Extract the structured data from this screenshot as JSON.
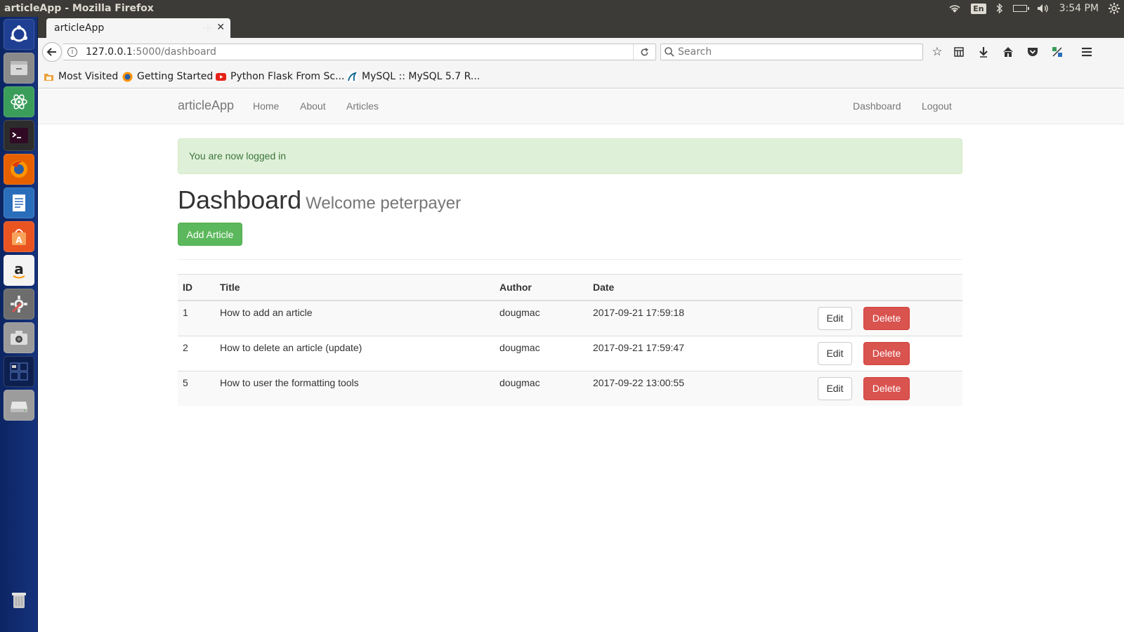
{
  "os": {
    "window_title": "articleApp - Mozilla Firefox",
    "keyboard_layout": "En",
    "clock": "3:54 PM"
  },
  "launcher": {
    "items": [
      "ubuntu-dash-icon",
      "files-icon",
      "atom-editor-icon",
      "terminal-icon",
      "firefox-icon",
      "writer-icon",
      "software-center-icon",
      "amazon-icon",
      "system-settings-icon",
      "camera-icon",
      "workspaces-icon",
      "drive-icon",
      "trash-icon"
    ]
  },
  "browser": {
    "tab_title": "articleApp",
    "url_host": "127.0.0.1",
    "url_path": ":5000/dashboard",
    "search_placeholder": "Search",
    "bookmarks": [
      {
        "label": "Most Visited"
      },
      {
        "label": "Getting Started"
      },
      {
        "label": "Python Flask From Sc..."
      },
      {
        "label": "MySQL :: MySQL 5.7 R..."
      }
    ]
  },
  "site": {
    "brand": "articleApp",
    "nav_left": [
      "Home",
      "About",
      "Articles"
    ],
    "nav_right": [
      "Dashboard",
      "Logout"
    ],
    "alert": "You are now logged in",
    "heading": "Dashboard",
    "welcome": "Welcome peterpayer",
    "add_button": "Add Article",
    "table": {
      "headers": [
        "ID",
        "Title",
        "Author",
        "Date"
      ],
      "rows": [
        {
          "id": "1",
          "title": "How to add an article",
          "author": "dougmac",
          "date": "2017-09-21 17:59:18"
        },
        {
          "id": "2",
          "title": "How to delete an article (update)",
          "author": "dougmac",
          "date": "2017-09-21 17:59:47"
        },
        {
          "id": "5",
          "title": "How to user the formatting tools",
          "author": "dougmac",
          "date": "2017-09-22 13:00:55"
        }
      ],
      "edit_label": "Edit",
      "delete_label": "Delete"
    }
  },
  "colors": {
    "success": "#5cb85c",
    "danger": "#d9534f",
    "alert_bg": "#dff0d8",
    "launcher_bg": "#15327c"
  }
}
